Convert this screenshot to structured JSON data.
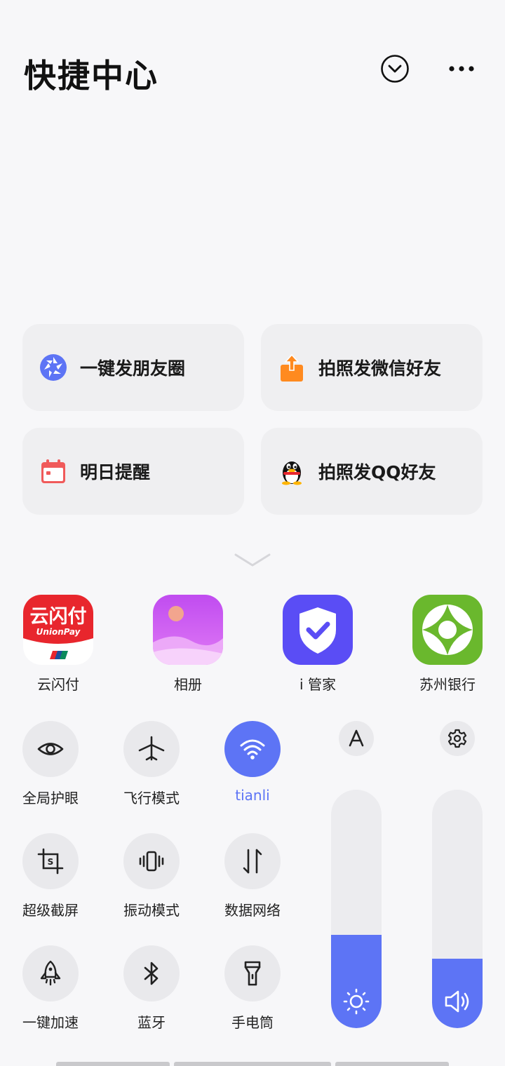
{
  "header": {
    "title": "快捷中心",
    "collapse_icon": "chevron-down-circle-icon",
    "more_icon": "more-dots-icon"
  },
  "shortcuts": [
    {
      "label": "一键发朋友圈",
      "icon": "wechat-moments-icon"
    },
    {
      "label": "拍照发微信好友",
      "icon": "share-upload-icon"
    },
    {
      "label": "明日提醒",
      "icon": "calendar-icon"
    },
    {
      "label": "拍照发QQ好友",
      "icon": "qq-penguin-icon"
    }
  ],
  "apps": [
    {
      "label": "云闪付",
      "icon_text": "云闪付",
      "icon_subtext": "UnionPay"
    },
    {
      "label": "相册",
      "icon": "gallery-icon"
    },
    {
      "label": "i 管家",
      "icon": "shield-check-icon"
    },
    {
      "label": "苏州银行",
      "icon": "suzhou-bank-icon"
    }
  ],
  "toggles": [
    {
      "label": "全局护眼",
      "icon": "eye-icon",
      "active": false
    },
    {
      "label": "飞行模式",
      "icon": "airplane-icon",
      "active": false
    },
    {
      "label": "tianli",
      "icon": "wifi-icon",
      "active": true
    },
    {
      "label": "超级截屏",
      "icon": "super-screenshot-icon",
      "active": false
    },
    {
      "label": "振动模式",
      "icon": "vibrate-icon",
      "active": false
    },
    {
      "label": "数据网络",
      "icon": "mobile-data-icon",
      "active": false
    },
    {
      "label": "一键加速",
      "icon": "rocket-icon",
      "active": false
    },
    {
      "label": "蓝牙",
      "icon": "bluetooth-icon",
      "active": false
    },
    {
      "label": "手电筒",
      "icon": "flashlight-icon",
      "active": false
    }
  ],
  "sliders": {
    "brightness": {
      "level_percent": 39,
      "icon": "sun-icon",
      "auto_icon": "auto-brightness-icon"
    },
    "volume": {
      "level_percent": 29,
      "icon": "speaker-icon",
      "settings_icon": "gear-icon"
    }
  },
  "colors": {
    "accent": "#5d74f5",
    "unionpay_red": "#e8262d",
    "bank_green": "#6ab82d",
    "ishield_purple": "#5a4df5",
    "calendar_red": "#f05a5a",
    "share_orange": "#ff8a1f"
  }
}
